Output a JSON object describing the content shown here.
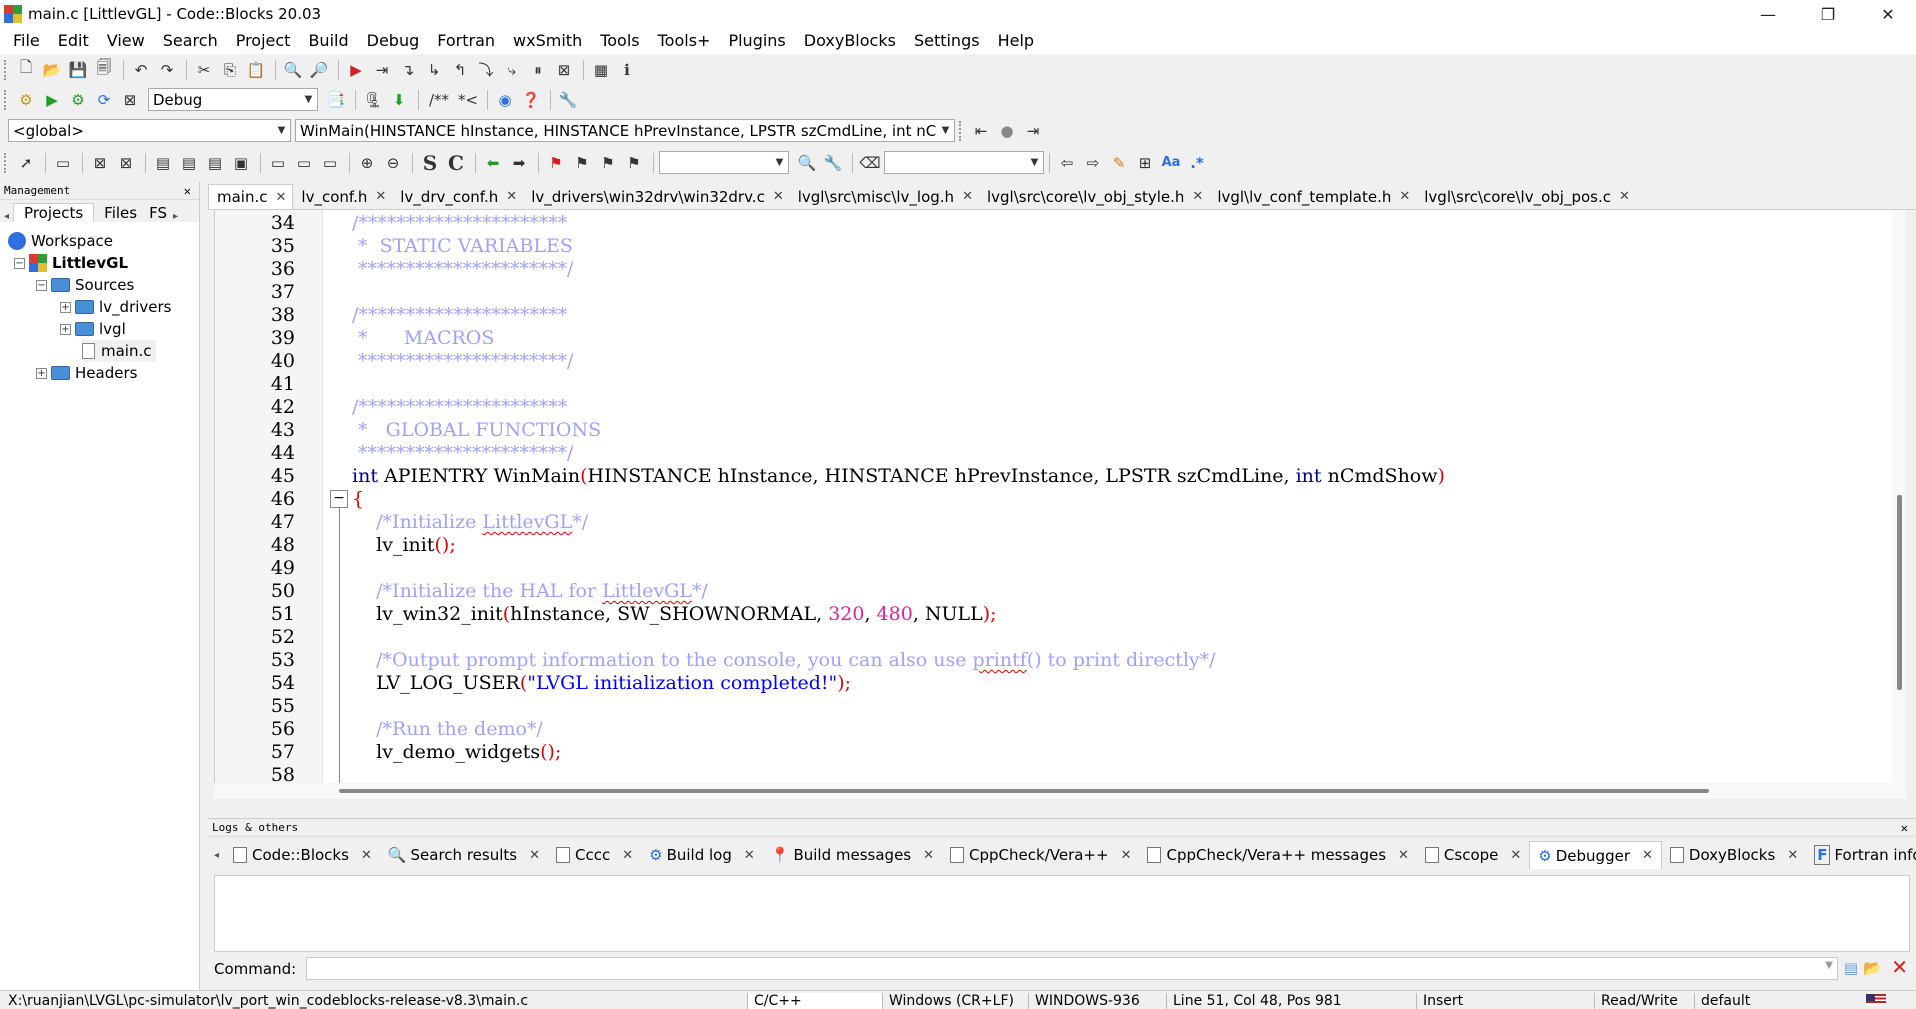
{
  "window": {
    "title": "main.c [LittlevGL] - Code::Blocks 20.03",
    "minimize": "—",
    "maximize": "❐",
    "close": "✕"
  },
  "menu": [
    "File",
    "Edit",
    "View",
    "Search",
    "Project",
    "Build",
    "Debug",
    "Fortran",
    "wxSmith",
    "Tools",
    "Tools+",
    "Plugins",
    "DoxyBlocks",
    "Settings",
    "Help"
  ],
  "toolbar": {
    "build_target": "Debug",
    "scope": "<global>",
    "function": "WinMain(HINSTANCE hInstance, HINSTANCE hPrevInstance, LPSTR szCmdLine, int nCmc",
    "comment_btn1": "/**",
    "comment_btn2": "*<",
    "find_S": "S",
    "find_C": "C",
    "regex_btn": ".*",
    "match_case": "Aa"
  },
  "management": {
    "title": "Management",
    "tabs": [
      "Projects",
      "Files",
      "FS"
    ],
    "tree": {
      "workspace": "Workspace",
      "project": "LittlevGL",
      "sources": "Sources",
      "lv_drivers": "lv_drivers",
      "lvgl": "lvgl",
      "main_c": "main.c",
      "headers": "Headers"
    }
  },
  "editor_tabs": [
    "main.c",
    "lv_conf.h",
    "lv_drv_conf.h",
    "lv_drivers\\win32drv\\win32drv.c",
    "lvgl\\src\\misc\\lv_log.h",
    "lvgl\\src\\core\\lv_obj_style.h",
    "lvgl\\lv_conf_template.h",
    "lvgl\\src\\core\\lv_obj_pos.c"
  ],
  "code": {
    "line_numbers": [
      "34",
      "35",
      "36",
      "37",
      "38",
      "39",
      "40",
      "41",
      "42",
      "43",
      "44",
      "45",
      "46",
      "47",
      "48",
      "49",
      "50",
      "51",
      "52",
      "53",
      "54",
      "55",
      "56",
      "57",
      "58"
    ],
    "l34": "/**********************",
    "l35": " *  STATIC VARIABLES",
    "l36": " **********************/",
    "l38": "/**********************",
    "l39": " *      MACROS",
    "l40": " **********************/",
    "l42": "/**********************",
    "l43": " *   GLOBAL FUNCTIONS",
    "l44": " **********************/",
    "l45_kw1": "int",
    "l45_a": " APIENTRY WinMain",
    "l45_p1": "(",
    "l45_b": "HINSTANCE hInstance, HINSTANCE hPrevInstance, LPSTR szCmdLine, ",
    "l45_kw2": "int",
    "l45_c": " nCmdShow",
    "l45_p2": ")",
    "l46": "{",
    "l47_a": "    /*Initialize ",
    "l47_b": "LittlevGL",
    "l47_c": "*/",
    "l48_a": "    lv_init",
    "l48_b": "();",
    "l50_a": "    /*Initialize the HAL for ",
    "l50_b": "LittlevGL",
    "l50_c": "*/",
    "l51_a": "    lv_win32_init",
    "l51_p1": "(",
    "l51_b": "hInstance, SW_SHOWNORMAL, ",
    "l51_n1": "320",
    "l51_c": ", ",
    "l51_n2": "480",
    "l51_d": ", NULL",
    "l51_p2": ");",
    "l53_a": "    /*Output prompt information to the console, you can also use ",
    "l53_b": "printf",
    "l53_c": "() to print directly*/",
    "l54_a": "    LV_LOG_USER",
    "l54_p1": "(",
    "l54_s": "\"LVGL initialization completed!\"",
    "l54_p2": ");",
    "l56": "    /*Run the demo*/",
    "l57_a": "    lv_demo_widgets",
    "l57_b": "();"
  },
  "logs": {
    "title": "Logs & others",
    "tabs": [
      "Code::Blocks",
      "Search results",
      "Cccc",
      "Build log",
      "Build messages",
      "CppCheck/Vera++",
      "CppCheck/Vera++ messages",
      "Cscope",
      "Debugger",
      "DoxyBlocks",
      "Fortran info"
    ],
    "command_label": "Command:"
  },
  "status": {
    "path": "X:\\ruanjian\\LVGL\\pc-simulator\\lv_port_win_codeblocks-release-v8.3\\main.c",
    "language": "C/C++",
    "eol": "Windows (CR+LF)",
    "encoding": "WINDOWS-936",
    "position": "Line 51, Col 48, Pos 981",
    "mode": "Insert",
    "access": "Read/Write",
    "profile": "default"
  },
  "colors": {
    "comment": "#8080ff",
    "keyword": "#00008b",
    "number": "#e0209c",
    "string": "#0000ff",
    "brace": "#e00000"
  }
}
